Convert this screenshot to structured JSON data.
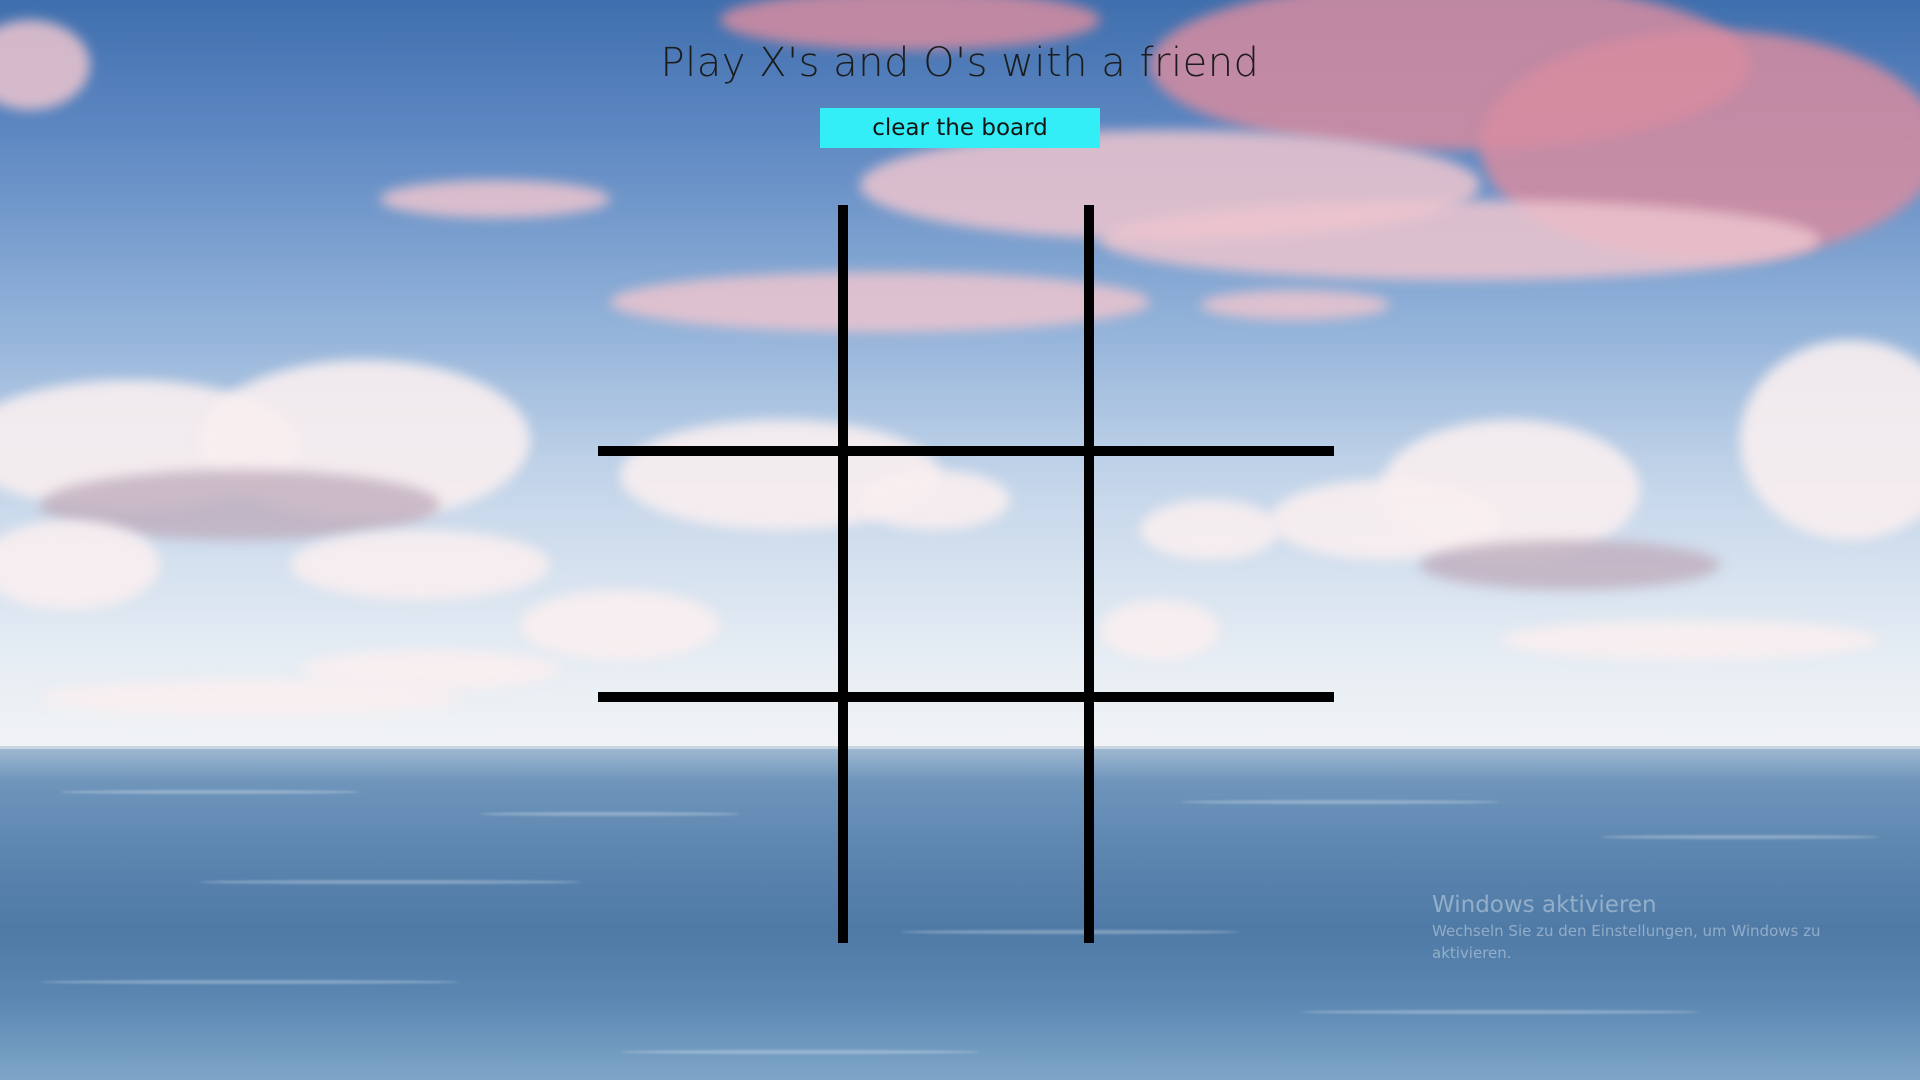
{
  "header": {
    "title": "Play X's and O's with a friend",
    "clear_button_label": "clear the board"
  },
  "board": {
    "cells": [
      "",
      "",
      "",
      "",
      "",
      "",
      "",
      "",
      ""
    ]
  },
  "watermark": {
    "title": "Windows aktivieren",
    "text": "Wechseln Sie zu den Einstellungen, um Windows zu aktivieren."
  },
  "colors": {
    "button_bg": "#33eef6",
    "grid_lines": "#000000"
  }
}
